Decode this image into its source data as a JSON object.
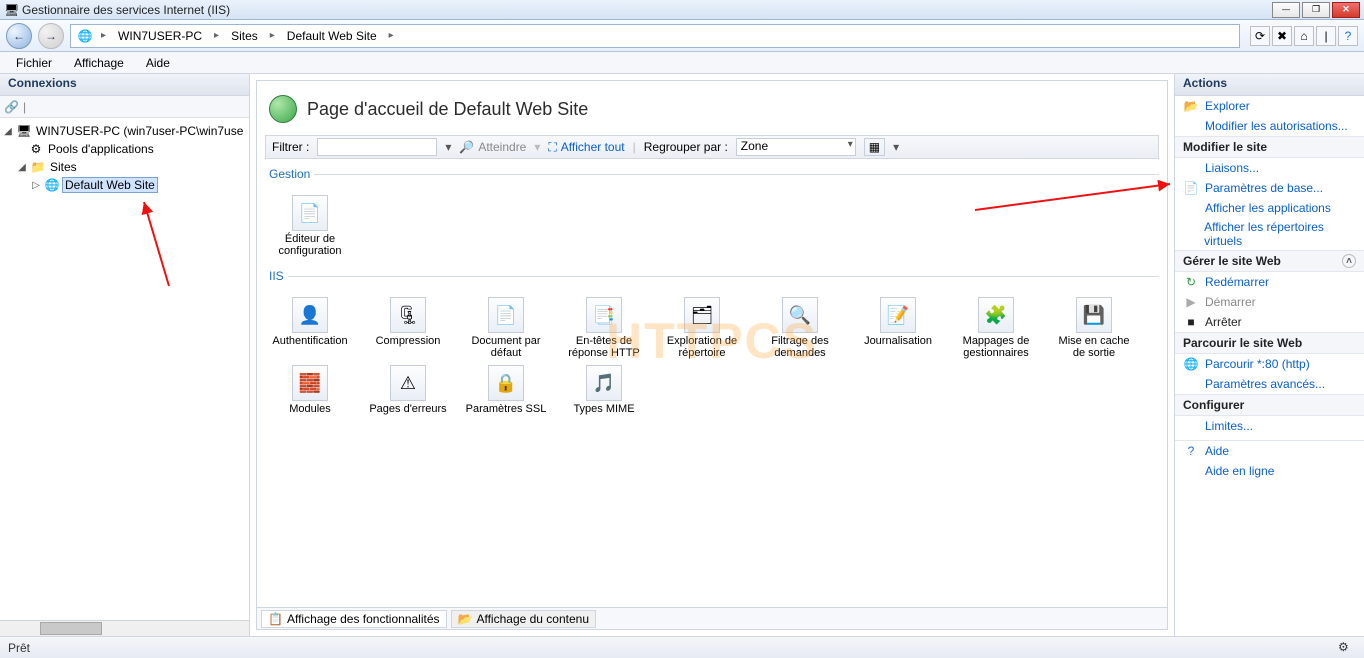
{
  "window": {
    "title": "Gestionnaire des services Internet (IIS)"
  },
  "breadcrumb": [
    "WIN7USER-PC",
    "Sites",
    "Default Web Site"
  ],
  "menubar": [
    "Fichier",
    "Affichage",
    "Aide"
  ],
  "left": {
    "title": "Connexions",
    "root": "WIN7USER-PC (win7user-PC\\win7use",
    "pools": "Pools d'applications",
    "sites": "Sites",
    "defaultSite": "Default Web Site"
  },
  "center": {
    "pageTitle": "Page d'accueil de Default Web Site",
    "filterLabel": "Filtrer :",
    "goLabel": "Atteindre",
    "showAllLabel": "Afficher tout",
    "groupByLabel": "Regrouper par :",
    "groupByValue": "Zone",
    "gestionLegend": "Gestion",
    "gestion": [
      {
        "name": "config-editor",
        "label": "Éditeur de configuration",
        "glyph": "📄"
      }
    ],
    "iisLegend": "IIS",
    "iis": [
      {
        "name": "authentication",
        "label": "Authentification",
        "glyph": "👤"
      },
      {
        "name": "compression",
        "label": "Compression",
        "glyph": "🗜"
      },
      {
        "name": "default-doc",
        "label": "Document par défaut",
        "glyph": "📄"
      },
      {
        "name": "http-headers",
        "label": "En-têtes de réponse HTTP",
        "glyph": "📑"
      },
      {
        "name": "dir-browsing",
        "label": "Exploration de répertoire",
        "glyph": "🗂"
      },
      {
        "name": "request-filter",
        "label": "Filtrage des demandes",
        "glyph": "🔍"
      },
      {
        "name": "logging",
        "label": "Journalisation",
        "glyph": "📝"
      },
      {
        "name": "handler-map",
        "label": "Mappages de gestionnaires",
        "glyph": "🧩"
      },
      {
        "name": "output-cache",
        "label": "Mise en cache de sortie",
        "glyph": "💾"
      },
      {
        "name": "modules",
        "label": "Modules",
        "glyph": "🧱"
      },
      {
        "name": "error-pages",
        "label": "Pages d'erreurs",
        "glyph": "⚠"
      },
      {
        "name": "ssl-settings",
        "label": "Paramètres SSL",
        "glyph": "🔒"
      },
      {
        "name": "mime-types",
        "label": "Types MIME",
        "glyph": "🎵"
      }
    ],
    "tab1": "Affichage des fonctionnalités",
    "tab2": "Affichage du contenu",
    "watermark": "HTTPCS"
  },
  "right": {
    "title": "Actions",
    "explore": "Explorer",
    "editPerm": "Modifier les autorisations...",
    "sectEditSite": "Modifier le site",
    "bindings": "Liaisons...",
    "basicSettings": "Paramètres de base...",
    "viewApps": "Afficher les applications",
    "viewVdirs": "Afficher les répertoires virtuels",
    "sectManage": "Gérer le site Web",
    "restart": "Redémarrer",
    "start": "Démarrer",
    "stop": "Arrêter",
    "sectBrowse": "Parcourir le site Web",
    "browse80": "Parcourir *:80 (http)",
    "advanced": "Paramètres avancés...",
    "sectConfigure": "Configurer",
    "limits": "Limites...",
    "help": "Aide",
    "onlineHelp": "Aide en ligne"
  },
  "status": {
    "ready": "Prêt"
  }
}
